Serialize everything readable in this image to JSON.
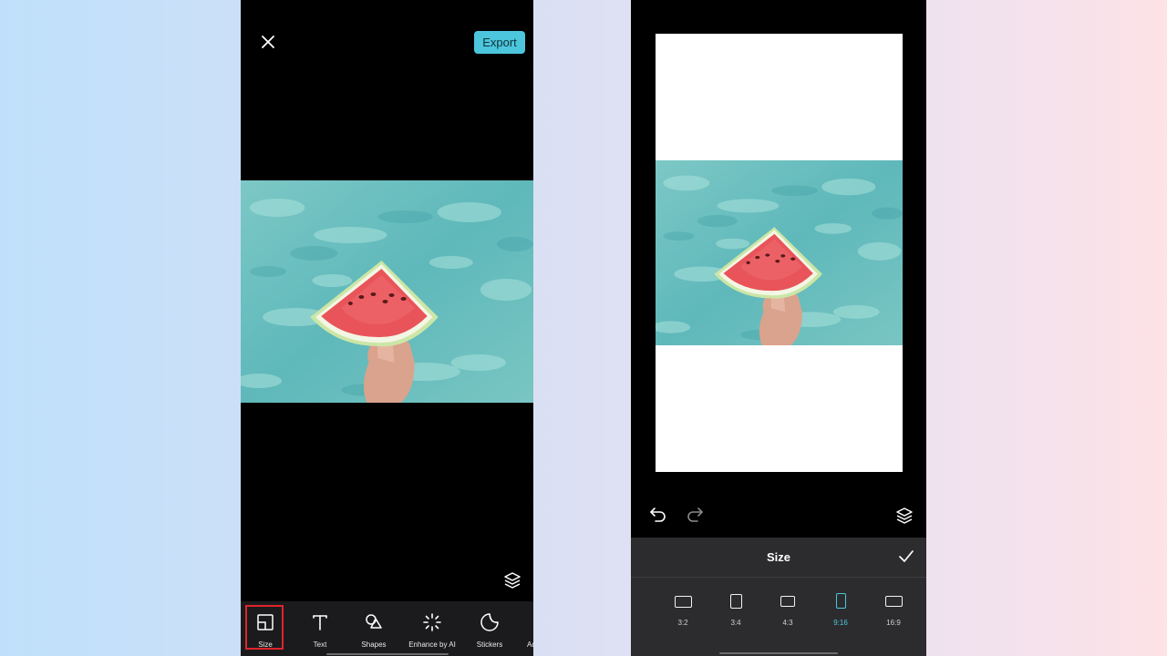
{
  "left_screen": {
    "export_label": "Export",
    "toolbar": [
      {
        "label": "Size",
        "icon": "size-icon",
        "selected": true
      },
      {
        "label": "Text",
        "icon": "text-icon"
      },
      {
        "label": "Shapes",
        "icon": "shapes-icon"
      },
      {
        "label": "Enhance by AI",
        "icon": "sparkle-icon"
      },
      {
        "label": "Stickers",
        "icon": "sticker-icon"
      },
      {
        "label": "Ad",
        "icon": ""
      }
    ]
  },
  "right_screen": {
    "panel_title": "Size",
    "ratios": [
      {
        "label": "3:2",
        "active": false
      },
      {
        "label": "3:4",
        "active": false
      },
      {
        "label": "4:3",
        "active": false
      },
      {
        "label": "9:16",
        "active": true
      },
      {
        "label": "16:9",
        "active": false
      }
    ]
  },
  "colors": {
    "accent": "#4cc6dc",
    "selection_outline": "#e0242b",
    "panel_bg": "#2c2c2e",
    "toolbar_bg": "#1b1b1d"
  }
}
